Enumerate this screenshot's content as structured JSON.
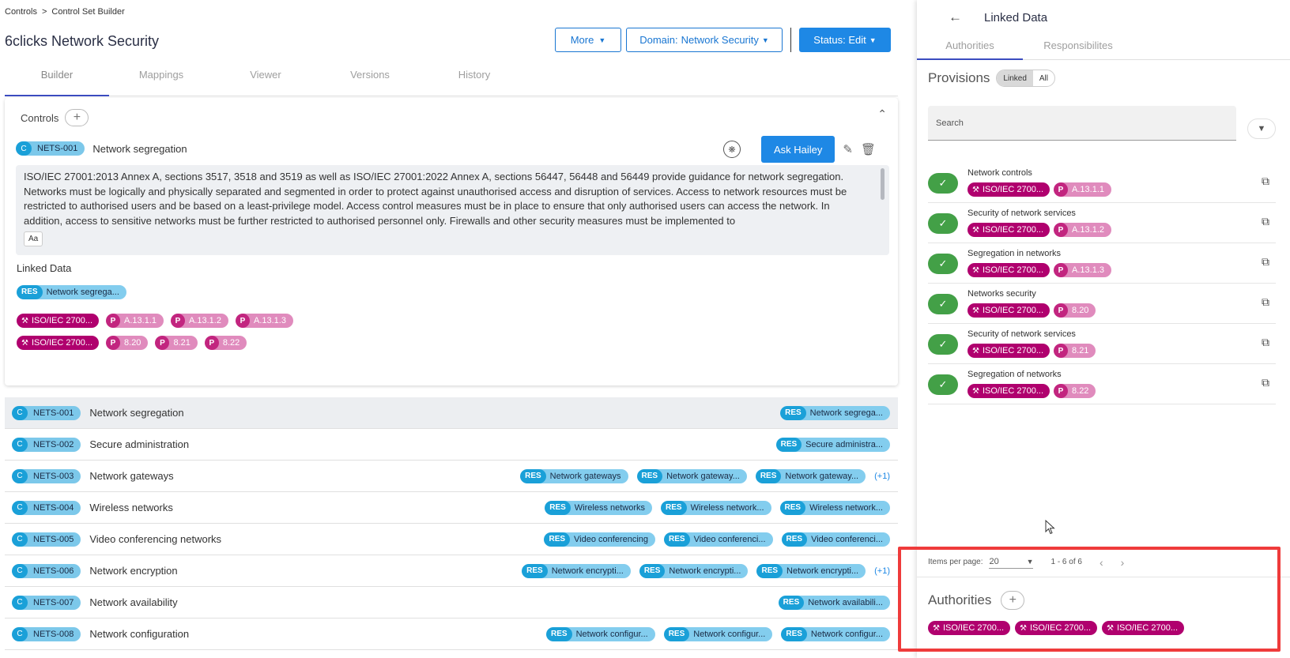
{
  "breadcrumb": {
    "root": "Controls",
    "sep": ">",
    "current": "Control Set Builder"
  },
  "page_title": "6clicks Network Security",
  "toolbar": {
    "more_label": "More",
    "domain_prefix": "Domain:",
    "domain_value": "Network Security",
    "status_label": "Status: Edit"
  },
  "tabs": [
    "Builder",
    "Mappings",
    "Viewer",
    "Versions",
    "History"
  ],
  "controls_card": {
    "title": "Controls",
    "control": {
      "badge": "C",
      "id": "NETS-001",
      "name": "Network segregation"
    },
    "ask_label": "Ask Hailey",
    "description": "ISO/IEC 27001:2013 Annex A, sections 3517, 3518 and 3519 as well as ISO/IEC 27001:2022 Annex A, sections 56447, 56448 and 56449 provide guidance for network segregation. Networks must be logically and physically separated and segmented in order to protect against unauthorised access and disruption of services. Access to network resources must be restricted to authorised users and be based on a least-privilege model. Access control measures must be in place to ensure that only authorised users can access the network. In addition, access to sensitive networks must be further restricted to authorised personnel only. Firewalls and other security measures must be implemented to",
    "aa_label": "Aa",
    "linked_data_label": "Linked Data",
    "linked_res": {
      "badge": "RES",
      "text": "Network segrega..."
    },
    "authority_rows": [
      {
        "authority": "ISO/IEC 2700...",
        "provisions": [
          "A.13.1.1",
          "A.13.1.2",
          "A.13.1.3"
        ]
      },
      {
        "authority": "ISO/IEC 2700...",
        "provisions": [
          "8.20",
          "8.21",
          "8.22"
        ]
      }
    ],
    "p_badge": "P"
  },
  "control_list": [
    {
      "id": "NETS-001",
      "name": "Network segregation",
      "res": [
        "Network segrega..."
      ],
      "more": ""
    },
    {
      "id": "NETS-002",
      "name": "Secure administration",
      "res": [
        "Secure administra..."
      ],
      "more": ""
    },
    {
      "id": "NETS-003",
      "name": "Network gateways",
      "res": [
        "Network gateways",
        "Network gateway...",
        "Network gateway..."
      ],
      "more": "(+1)"
    },
    {
      "id": "NETS-004",
      "name": "Wireless networks",
      "res": [
        "Wireless networks",
        "Wireless network...",
        "Wireless network..."
      ],
      "more": ""
    },
    {
      "id": "NETS-005",
      "name": "Video conferencing networks",
      "res": [
        "Video conferencing",
        "Video conferenci...",
        "Video conferenci..."
      ],
      "more": ""
    },
    {
      "id": "NETS-006",
      "name": "Network encryption",
      "res": [
        "Network encrypti...",
        "Network encrypti...",
        "Network encrypti..."
      ],
      "more": "(+1)"
    },
    {
      "id": "NETS-007",
      "name": "Network availability",
      "res": [
        "Network availabili..."
      ],
      "more": ""
    },
    {
      "id": "NETS-008",
      "name": "Network configuration",
      "res": [
        "Network configur...",
        "Network configur...",
        "Network configur..."
      ],
      "more": ""
    }
  ],
  "panel": {
    "title": "Linked Data",
    "tabs": [
      "Authorities",
      "Responsibilites"
    ],
    "provisions_title": "Provisions",
    "toggle": [
      "Linked",
      "All"
    ],
    "search_placeholder": "Search",
    "provisions": [
      {
        "name": "Network controls",
        "authority": "ISO/IEC 2700...",
        "provision": "A.13.1.1"
      },
      {
        "name": "Security of network services",
        "authority": "ISO/IEC 2700...",
        "provision": "A.13.1.2"
      },
      {
        "name": "Segregation in networks",
        "authority": "ISO/IEC 2700...",
        "provision": "A.13.1.3"
      },
      {
        "name": "Networks security",
        "authority": "ISO/IEC 2700...",
        "provision": "8.20"
      },
      {
        "name": "Security of network services",
        "authority": "ISO/IEC 2700...",
        "provision": "8.21"
      },
      {
        "name": "Segregation of networks",
        "authority": "ISO/IEC 2700...",
        "provision": "8.22"
      }
    ],
    "pager": {
      "label": "Items per page:",
      "per_page": "20",
      "range": "1 - 6 of 6"
    },
    "authorities_title": "Authorities",
    "authorities": [
      "ISO/IEC 2700...",
      "ISO/IEC 2700...",
      "ISO/IEC 2700..."
    ]
  },
  "colors": {
    "accent": "#1e88e5",
    "authority": "#b0006e",
    "provision": "#e08bbd",
    "control": "#1aa0d8",
    "check": "#43a047",
    "highlight": "#ef3b3b"
  }
}
